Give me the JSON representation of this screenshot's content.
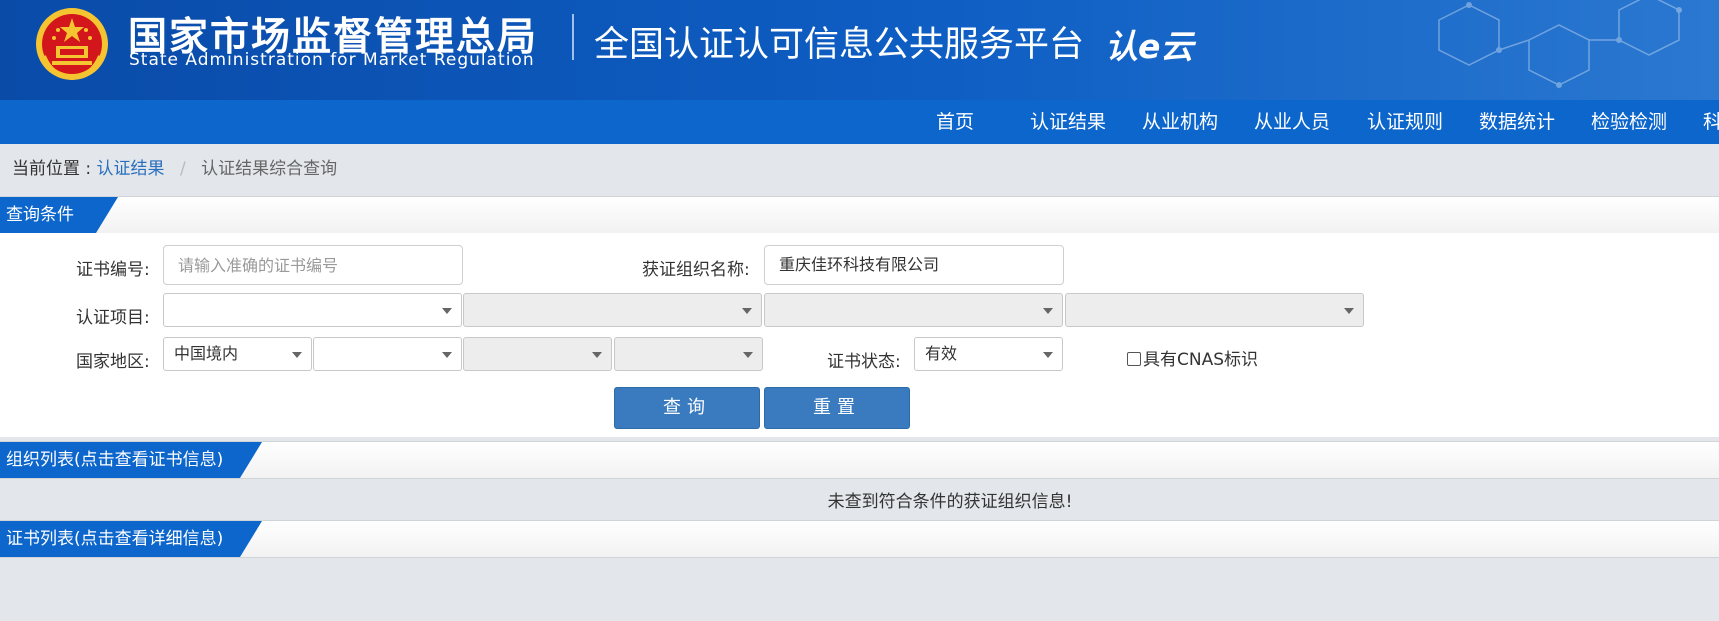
{
  "header": {
    "agency_cn": "国家市场监督管理总局",
    "agency_en": "State Administration  for  Market Regulation",
    "platform": "全国认证认可信息公共服务平台",
    "logo_text": "认e云"
  },
  "nav": {
    "items": [
      "首页",
      "认证结果",
      "从业机构",
      "从业人员",
      "认证规则",
      "数据统计",
      "检验检测",
      "科"
    ]
  },
  "breadcrumb": {
    "prefix": "当前位置 :",
    "link": "认证结果",
    "separator": "/",
    "current": "认证结果综合查询"
  },
  "query": {
    "section_title": "查询条件",
    "cert_no_label": "证书编号:",
    "cert_no_placeholder": "请输入准确的证书编号",
    "cert_no_value": "",
    "org_name_label": "获证组织名称:",
    "org_name_value": "重庆佳环科技有限公司",
    "cert_project_label": "认证项目:",
    "cert_project_selects": [
      "",
      "",
      "",
      ""
    ],
    "region_label": "国家地区:",
    "region_selects": [
      "中国境内",
      "",
      "",
      ""
    ],
    "status_label": "证书状态:",
    "status_value": "有效",
    "cnas_label": "具有CNAS标识",
    "search_button": "查询",
    "reset_button": "重置"
  },
  "org_list": {
    "section_title": "组织列表(点击查看证书信息)",
    "empty_message": "未查到符合条件的获证组织信息!"
  },
  "cert_list": {
    "section_title": "证书列表(点击查看详细信息)"
  },
  "colors": {
    "header_blue": "#0a4ba8",
    "nav_blue": "#0c66cc",
    "button_blue": "#3a7bbf",
    "link_blue": "#2a6fbd",
    "emblem_red": "#d2161c",
    "emblem_gold": "#f5c431"
  }
}
